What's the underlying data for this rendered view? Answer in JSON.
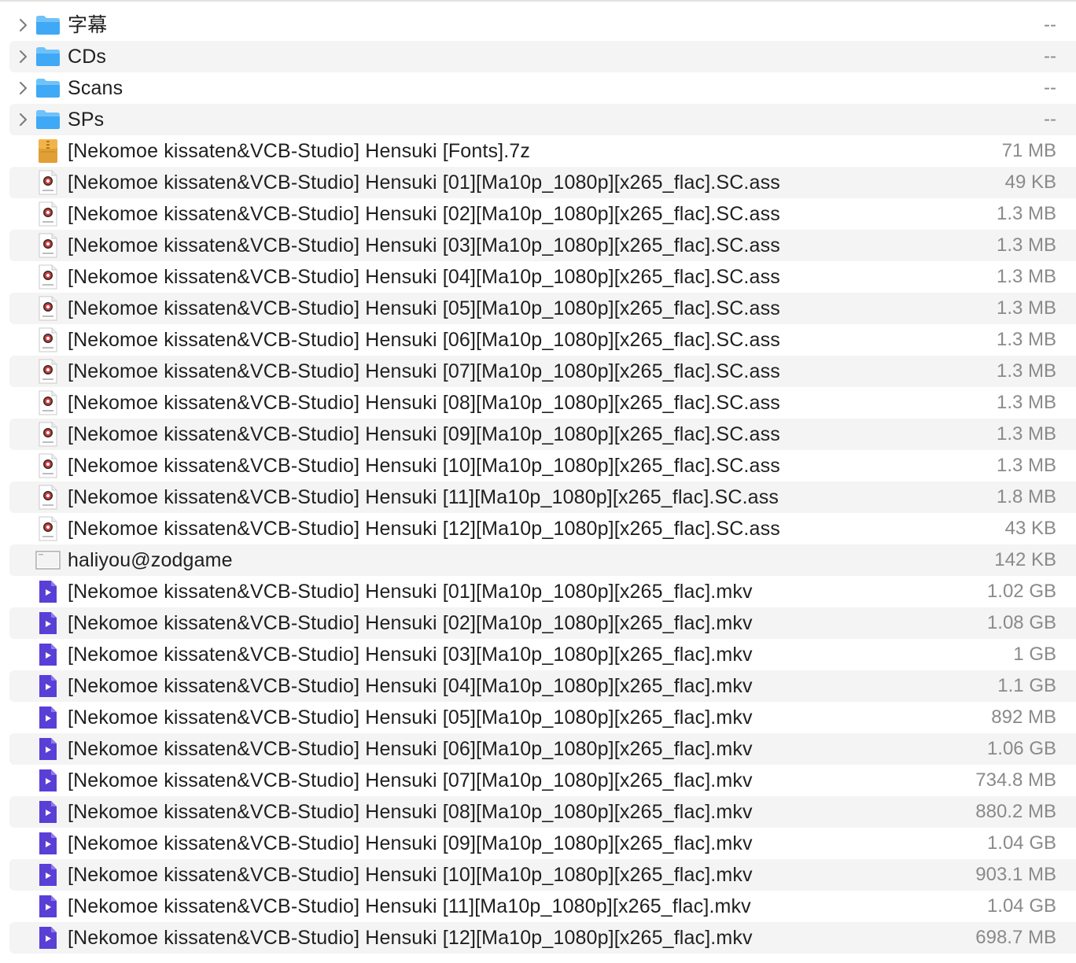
{
  "files": [
    {
      "name": "字幕",
      "size": "--",
      "kind": "folder",
      "icon": "folder-icon",
      "expandable": true
    },
    {
      "name": "CDs",
      "size": "--",
      "kind": "folder",
      "icon": "folder-icon",
      "expandable": true
    },
    {
      "name": "Scans",
      "size": "--",
      "kind": "folder",
      "icon": "folder-icon",
      "expandable": true
    },
    {
      "name": "SPs",
      "size": "--",
      "kind": "folder",
      "icon": "folder-icon",
      "expandable": true
    },
    {
      "name": "[Nekomoe kissaten&VCB-Studio] Hensuki [Fonts].7z",
      "size": "71 MB",
      "kind": "archive",
      "icon": "archive-7z-icon",
      "icon_label": "7z"
    },
    {
      "name": "[Nekomoe kissaten&VCB-Studio] Hensuki [01][Ma10p_1080p][x265_flac].SC.ass",
      "size": "49 KB",
      "kind": "subtitle",
      "icon": "ass-subtitle-icon",
      "icon_label": "ASS"
    },
    {
      "name": "[Nekomoe kissaten&VCB-Studio] Hensuki [02][Ma10p_1080p][x265_flac].SC.ass",
      "size": "1.3 MB",
      "kind": "subtitle",
      "icon": "ass-subtitle-icon",
      "icon_label": "ASS"
    },
    {
      "name": "[Nekomoe kissaten&VCB-Studio] Hensuki [03][Ma10p_1080p][x265_flac].SC.ass",
      "size": "1.3 MB",
      "kind": "subtitle",
      "icon": "ass-subtitle-icon",
      "icon_label": "ASS"
    },
    {
      "name": "[Nekomoe kissaten&VCB-Studio] Hensuki [04][Ma10p_1080p][x265_flac].SC.ass",
      "size": "1.3 MB",
      "kind": "subtitle",
      "icon": "ass-subtitle-icon",
      "icon_label": "ASS"
    },
    {
      "name": "[Nekomoe kissaten&VCB-Studio] Hensuki [05][Ma10p_1080p][x265_flac].SC.ass",
      "size": "1.3 MB",
      "kind": "subtitle",
      "icon": "ass-subtitle-icon",
      "icon_label": "ASS"
    },
    {
      "name": "[Nekomoe kissaten&VCB-Studio] Hensuki [06][Ma10p_1080p][x265_flac].SC.ass",
      "size": "1.3 MB",
      "kind": "subtitle",
      "icon": "ass-subtitle-icon",
      "icon_label": "ASS"
    },
    {
      "name": "[Nekomoe kissaten&VCB-Studio] Hensuki [07][Ma10p_1080p][x265_flac].SC.ass",
      "size": "1.3 MB",
      "kind": "subtitle",
      "icon": "ass-subtitle-icon",
      "icon_label": "ASS"
    },
    {
      "name": "[Nekomoe kissaten&VCB-Studio] Hensuki [08][Ma10p_1080p][x265_flac].SC.ass",
      "size": "1.3 MB",
      "kind": "subtitle",
      "icon": "ass-subtitle-icon",
      "icon_label": "ASS"
    },
    {
      "name": "[Nekomoe kissaten&VCB-Studio] Hensuki [09][Ma10p_1080p][x265_flac].SC.ass",
      "size": "1.3 MB",
      "kind": "subtitle",
      "icon": "ass-subtitle-icon",
      "icon_label": "ASS"
    },
    {
      "name": "[Nekomoe kissaten&VCB-Studio] Hensuki [10][Ma10p_1080p][x265_flac].SC.ass",
      "size": "1.3 MB",
      "kind": "subtitle",
      "icon": "ass-subtitle-icon",
      "icon_label": "ASS"
    },
    {
      "name": "[Nekomoe kissaten&VCB-Studio] Hensuki [11][Ma10p_1080p][x265_flac].SC.ass",
      "size": "1.8 MB",
      "kind": "subtitle",
      "icon": "ass-subtitle-icon",
      "icon_label": "ASS"
    },
    {
      "name": "[Nekomoe kissaten&VCB-Studio] Hensuki [12][Ma10p_1080p][x265_flac].SC.ass",
      "size": "43 KB",
      "kind": "subtitle",
      "icon": "ass-subtitle-icon",
      "icon_label": "ASS"
    },
    {
      "name": "haliyou@zodgame",
      "size": "142 KB",
      "kind": "image",
      "icon": "image-thumbnail-icon"
    },
    {
      "name": "[Nekomoe kissaten&VCB-Studio] Hensuki [01][Ma10p_1080p][x265_flac].mkv",
      "size": "1.02 GB",
      "kind": "video",
      "icon": "video-file-icon"
    },
    {
      "name": "[Nekomoe kissaten&VCB-Studio] Hensuki [02][Ma10p_1080p][x265_flac].mkv",
      "size": "1.08 GB",
      "kind": "video",
      "icon": "video-file-icon"
    },
    {
      "name": "[Nekomoe kissaten&VCB-Studio] Hensuki [03][Ma10p_1080p][x265_flac].mkv",
      "size": "1 GB",
      "kind": "video",
      "icon": "video-file-icon"
    },
    {
      "name": "[Nekomoe kissaten&VCB-Studio] Hensuki [04][Ma10p_1080p][x265_flac].mkv",
      "size": "1.1 GB",
      "kind": "video",
      "icon": "video-file-icon"
    },
    {
      "name": "[Nekomoe kissaten&VCB-Studio] Hensuki [05][Ma10p_1080p][x265_flac].mkv",
      "size": "892 MB",
      "kind": "video",
      "icon": "video-file-icon"
    },
    {
      "name": "[Nekomoe kissaten&VCB-Studio] Hensuki [06][Ma10p_1080p][x265_flac].mkv",
      "size": "1.06 GB",
      "kind": "video",
      "icon": "video-file-icon"
    },
    {
      "name": "[Nekomoe kissaten&VCB-Studio] Hensuki [07][Ma10p_1080p][x265_flac].mkv",
      "size": "734.8 MB",
      "kind": "video",
      "icon": "video-file-icon"
    },
    {
      "name": "[Nekomoe kissaten&VCB-Studio] Hensuki [08][Ma10p_1080p][x265_flac].mkv",
      "size": "880.2 MB",
      "kind": "video",
      "icon": "video-file-icon"
    },
    {
      "name": "[Nekomoe kissaten&VCB-Studio] Hensuki [09][Ma10p_1080p][x265_flac].mkv",
      "size": "1.04 GB",
      "kind": "video",
      "icon": "video-file-icon"
    },
    {
      "name": "[Nekomoe kissaten&VCB-Studio] Hensuki [10][Ma10p_1080p][x265_flac].mkv",
      "size": "903.1 MB",
      "kind": "video",
      "icon": "video-file-icon"
    },
    {
      "name": "[Nekomoe kissaten&VCB-Studio] Hensuki [11][Ma10p_1080p][x265_flac].mkv",
      "size": "1.04 GB",
      "kind": "video",
      "icon": "video-file-icon"
    },
    {
      "name": "[Nekomoe kissaten&VCB-Studio] Hensuki [12][Ma10p_1080p][x265_flac].mkv",
      "size": "698.7 MB",
      "kind": "video",
      "icon": "video-file-icon"
    }
  ],
  "colors": {
    "folder": "#3fa9f5",
    "folder_tab": "#6ec2fa",
    "archive": "#e0a035",
    "video": "#5a3fd6",
    "row_alt": "#f4f4f4",
    "size_text": "#8a8a8a",
    "name_text": "#1f1f1f",
    "chevron": "#7a7a7a"
  }
}
